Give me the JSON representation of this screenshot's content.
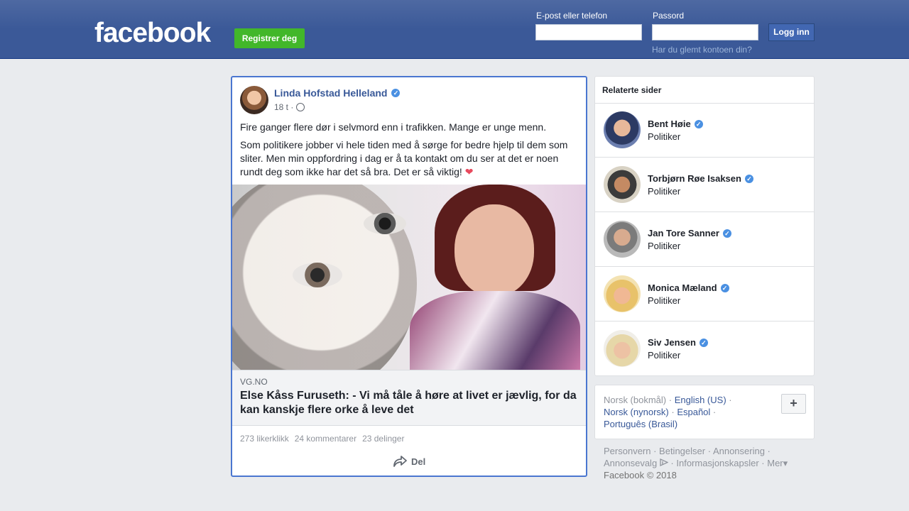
{
  "header": {
    "logo": "facebook",
    "register_label": "Registrer deg",
    "email_label": "E-post eller telefon",
    "password_label": "Passord",
    "login_label": "Logg inn",
    "forgot_label": "Har du glemt kontoen din?"
  },
  "post": {
    "author": "Linda Hofstad Helleland",
    "time": "18 t ·",
    "text1": "Fire ganger flere dør i selvmord enn i trafikken. Mange er unge menn.",
    "text2": "Som politikere jobber vi hele tiden med å sørge for bedre hjelp til dem som sliter. Men min oppfordring i dag er å ta kontakt om du ser at det er noen rundt deg som ikke har det så bra. Det er så viktig!",
    "heart": "❤",
    "link_domain": "VG.NO",
    "link_title": "Else Kåss Furuseth: - Vi må tåle å høre at livet er jævlig, for da kan kanskje flere orke å leve det",
    "likes": "273 likerklikk",
    "comments": "24 kommentarer",
    "shares": "23 delinger",
    "share_label": "Del"
  },
  "related": {
    "title": "Relaterte sider",
    "people": [
      {
        "name": "Bent Høie",
        "role": "Politiker"
      },
      {
        "name": "Torbjørn Røe Isaksen",
        "role": "Politiker"
      },
      {
        "name": "Jan Tore Sanner",
        "role": "Politiker"
      },
      {
        "name": "Monica Mæland",
        "role": "Politiker"
      },
      {
        "name": "Siv Jensen",
        "role": "Politiker"
      }
    ]
  },
  "languages": {
    "current": "Norsk (bokmål)",
    "options": [
      "English (US)",
      "Norsk (nynorsk)",
      "Español",
      "Português (Brasil)"
    ],
    "more_label": "+"
  },
  "footer": {
    "links": [
      "Personvern",
      "Betingelser",
      "Annonsering",
      "Annonsevalg",
      "Informasjonskapsler",
      "Mer"
    ],
    "copyright": "Facebook © 2018"
  }
}
